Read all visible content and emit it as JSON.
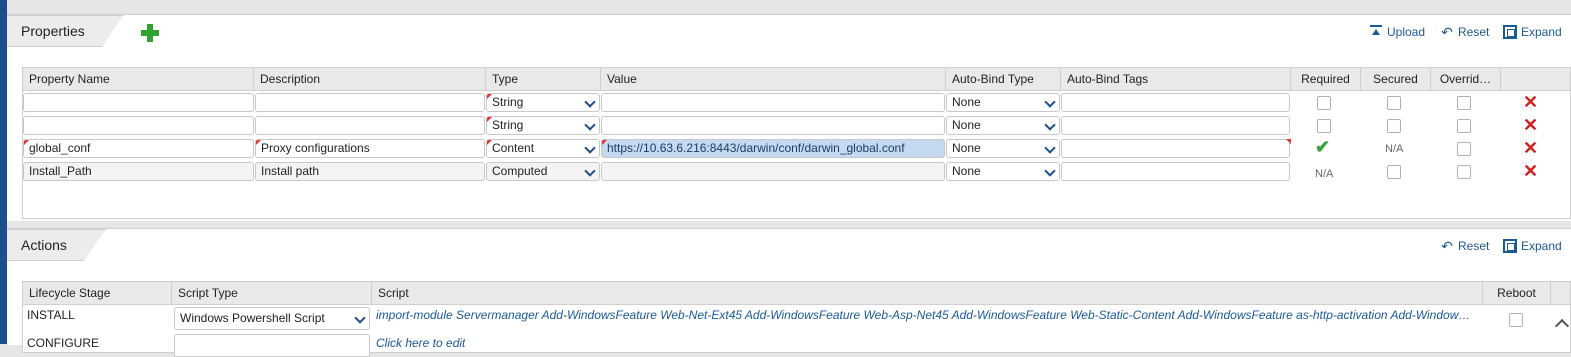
{
  "properties": {
    "title": "Properties",
    "actions": {
      "upload": "Upload",
      "reset": "Reset",
      "expand": "Expand"
    },
    "columns": [
      "Property Name",
      "Description",
      "Type",
      "Value",
      "Auto-Bind Type",
      "Auto-Bind Tags",
      "Required",
      "Secured",
      "Overrid…"
    ],
    "rows": [
      {
        "name": "",
        "description": "",
        "type": "String",
        "value": "",
        "autobind_type": "None",
        "autobind_tags": ""
      },
      {
        "name": "",
        "description": "",
        "type": "String",
        "value": "",
        "autobind_type": "None",
        "autobind_tags": ""
      },
      {
        "name": "global_conf",
        "description": "Proxy configurations",
        "type": "Content",
        "value": "https://10.63.6.216:8443/darwin/conf/darwin_global.conf",
        "autobind_type": "None",
        "autobind_tags": "",
        "secured_text": "N/A"
      },
      {
        "name": "Install_Path",
        "description": "Install path",
        "type": "Computed",
        "value": "",
        "autobind_type": "None",
        "autobind_tags": "",
        "required_text": "N/A"
      }
    ]
  },
  "actions_panel": {
    "title": "Actions",
    "actions": {
      "reset": "Reset",
      "expand": "Expand"
    },
    "columns": [
      "Lifecycle Stage",
      "Script Type",
      "Script",
      "Reboot"
    ],
    "rows": [
      {
        "stage": "INSTALL",
        "script_type": "Windows Powershell Script",
        "script": "import-module Servermanager Add-WindowsFeature Web-Net-Ext45 Add-WindowsFeature Web-Asp-Net45 Add-WindowsFeature Web-Static-Content Add-WindowsFeature as-http-activation Add-Windows…"
      },
      {
        "stage": "CONFIGURE",
        "script_type": "",
        "script": "Click here to edit"
      }
    ]
  },
  "colors": {
    "accent": "#1b5a96",
    "delete": "#d21f1f",
    "add": "#2fa32f",
    "selected": "#c5d9f1"
  }
}
